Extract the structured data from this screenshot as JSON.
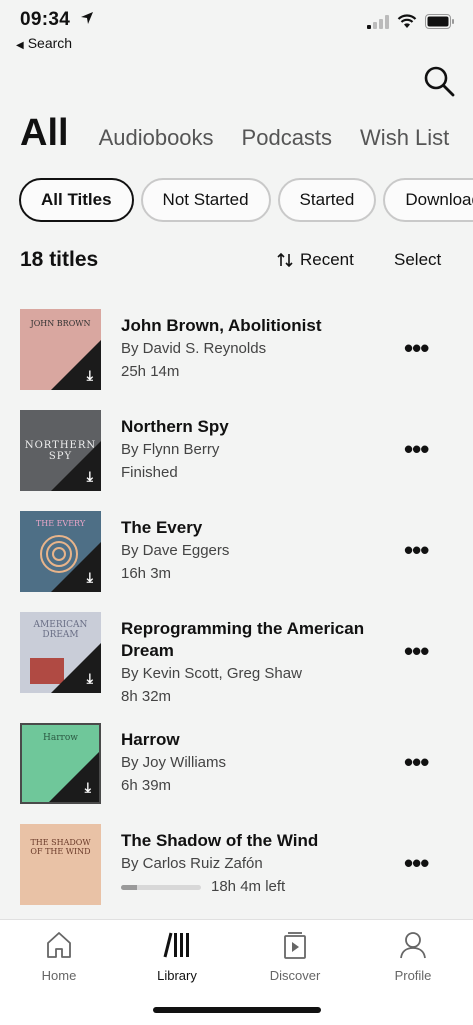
{
  "status_bar": {
    "time": "09:34",
    "back_label": "Search"
  },
  "tabs": [
    {
      "label": "All",
      "active": true
    },
    {
      "label": "Audiobooks",
      "active": false
    },
    {
      "label": "Podcasts",
      "active": false
    },
    {
      "label": "Wish List",
      "active": false
    }
  ],
  "filters": [
    {
      "label": "All Titles",
      "active": true
    },
    {
      "label": "Not Started",
      "active": false
    },
    {
      "label": "Started",
      "active": false
    },
    {
      "label": "Downloaded",
      "active": false
    }
  ],
  "list_header": {
    "count": "18 titles",
    "sort_label": "Recent",
    "select_label": "Select"
  },
  "titles": [
    {
      "title": "John Brown, Abolitionist",
      "author": "By David S. Reynolds",
      "meta": "25h 14m",
      "cover_text": "JOHN BROWN",
      "cover_color": "#d9a7a0"
    },
    {
      "title": "Northern Spy",
      "author": "By Flynn Berry",
      "meta": "Finished",
      "cover_text": "NORTHERN SPY",
      "cover_color": "#5e6063"
    },
    {
      "title": "The Every",
      "author": "By Dave Eggers",
      "meta": "16h 3m",
      "cover_text": "THE EVERY",
      "cover_color": "#4e6f86"
    },
    {
      "title": "Reprogramming the American Dream",
      "author": "By Kevin Scott, Greg Shaw",
      "meta": "8h 32m",
      "cover_text": "AMERICAN DREAM",
      "cover_color": "#c9cdd8"
    },
    {
      "title": "Harrow",
      "author": "By Joy Williams",
      "meta": "6h 39m",
      "cover_text": "Harrow",
      "cover_color": "#6fc79a"
    },
    {
      "title": "The Shadow of the Wind",
      "author": "By Carlos Ruiz Zafón",
      "meta": "18h 4m left",
      "progress": 0.2,
      "cover_text": "THE SHADOW OF THE WIND",
      "cover_color": "#e9c2a6"
    }
  ],
  "tabbar": [
    {
      "label": "Home",
      "icon": "home-icon",
      "active": false
    },
    {
      "label": "Library",
      "icon": "library-icon",
      "active": true
    },
    {
      "label": "Discover",
      "icon": "discover-icon",
      "active": false
    },
    {
      "label": "Profile",
      "icon": "profile-icon",
      "active": false
    }
  ]
}
